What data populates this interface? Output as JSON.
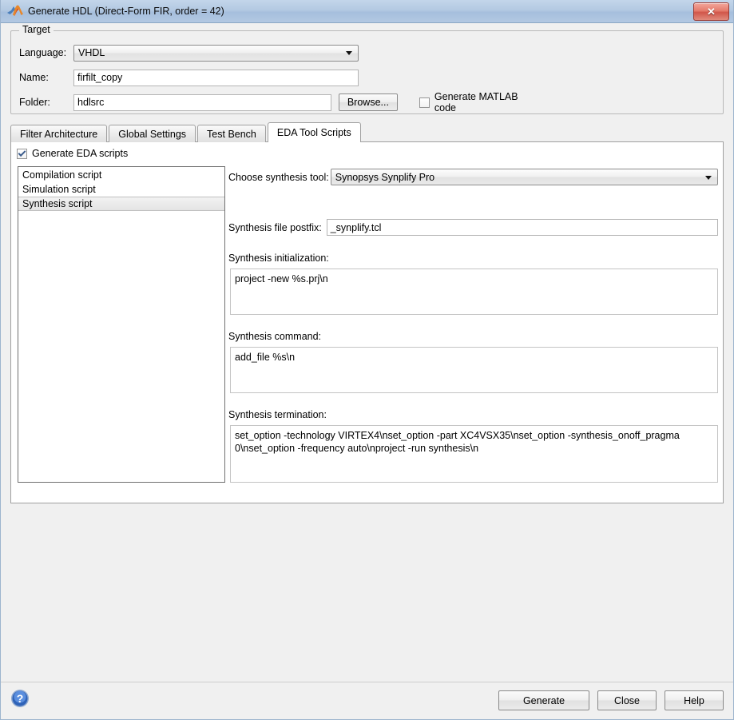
{
  "window": {
    "title": "Generate HDL (Direct-Form FIR, order = 42)",
    "logo_icon": "matlab-membrane-icon",
    "close_label": "✕"
  },
  "target": {
    "legend": "Target",
    "language_label": "Language:",
    "language_value": "VHDL",
    "name_label": "Name:",
    "name_value": "firfilt_copy",
    "folder_label": "Folder:",
    "folder_value": "hdlsrc",
    "browse_label": "Browse...",
    "generate_matlab_label": "Generate MATLAB code",
    "generate_matlab_checked": false
  },
  "tabs": [
    {
      "label": "Filter Architecture",
      "active": false
    },
    {
      "label": "Global Settings",
      "active": false
    },
    {
      "label": "Test Bench",
      "active": false
    },
    {
      "label": "EDA Tool Scripts",
      "active": true
    }
  ],
  "eda": {
    "generate_eda_label": "Generate EDA scripts",
    "generate_eda_checked": true,
    "script_list": [
      {
        "label": "Compilation script",
        "selected": false
      },
      {
        "label": "Simulation script",
        "selected": false
      },
      {
        "label": "Synthesis script",
        "selected": true
      }
    ],
    "tool_label": "Choose synthesis tool:",
    "tool_value": "Synopsys Synplify Pro",
    "postfix_label": "Synthesis file postfix:",
    "postfix_value": "_synplify.tcl",
    "init_label": "Synthesis initialization:",
    "init_value": "project -new %s.prj\\n",
    "command_label": "Synthesis command:",
    "command_value": "add_file %s\\n",
    "termination_label": "Synthesis termination:",
    "termination_value": "set_option -technology VIRTEX4\\nset_option -part XC4VSX35\\nset_option -synthesis_onoff_pragma 0\\nset_option -frequency auto\\nproject -run synthesis\\n"
  },
  "footer": {
    "help_icon": "help-circle-icon",
    "generate_label": "Generate",
    "close_label": "Close",
    "help_label": "Help"
  },
  "colors": {
    "window_bg": "#f0f0f0",
    "titlebar": "#b3c9e2",
    "panel_bg": "#ffffff",
    "close_red": "#d1564a",
    "help_blue": "#3b6fc0"
  }
}
